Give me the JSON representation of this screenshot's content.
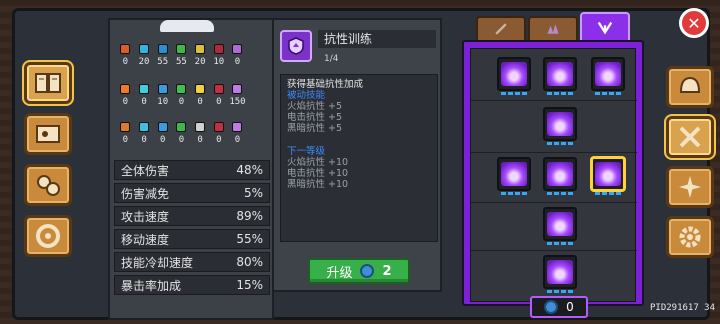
{
  "resources": {
    "row1": [
      {
        "icon": "fire-shield-icon",
        "color": "#e05a2a",
        "value": "0"
      },
      {
        "icon": "ice-shield-icon",
        "color": "#2fb6e0",
        "value": "20"
      },
      {
        "icon": "water-shield-icon",
        "color": "#2a8fd0",
        "value": "55"
      },
      {
        "icon": "poison-shield-icon",
        "color": "#3fb84a",
        "value": "55"
      },
      {
        "icon": "light-shield-icon",
        "color": "#d9c23a",
        "value": "20"
      },
      {
        "icon": "dark-shield-icon",
        "color": "#b02a3a",
        "value": "10"
      },
      {
        "icon": "arcane-shield-icon",
        "color": "#b06ad8",
        "value": "0"
      }
    ],
    "row2": [
      {
        "icon": "flame-icon",
        "color": "#f07a2a",
        "value": "0"
      },
      {
        "icon": "crystal-icon",
        "color": "#3ed0e0",
        "value": "0"
      },
      {
        "icon": "drop-icon",
        "color": "#3a9be0",
        "value": "10"
      },
      {
        "icon": "skull-icon",
        "color": "#3fc04a",
        "value": "0"
      },
      {
        "icon": "sun-icon",
        "color": "#f0d23a",
        "value": "0"
      },
      {
        "icon": "moon-icon",
        "color": "#c03040",
        "value": "0"
      },
      {
        "icon": "star-icon",
        "color": "#c07ae8",
        "value": "150"
      }
    ],
    "row3": [
      {
        "icon": "fire-staff-icon",
        "color": "#e07a2a",
        "value": "0"
      },
      {
        "icon": "ice-staff-icon",
        "color": "#3ec0e0",
        "value": "0"
      },
      {
        "icon": "water-staff-icon",
        "color": "#3a9be0",
        "value": "0"
      },
      {
        "icon": "poison-staff-icon",
        "color": "#3fb84a",
        "value": "0"
      },
      {
        "icon": "light-staff-icon",
        "color": "#d0d0d0",
        "value": "0"
      },
      {
        "icon": "dark-staff-icon",
        "color": "#c03040",
        "value": "0"
      },
      {
        "icon": "arcane-staff-icon",
        "color": "#c07ae8",
        "value": "0"
      }
    ]
  },
  "stats": [
    {
      "label": "全体伤害",
      "value": "48%"
    },
    {
      "label": "伤害减免",
      "value": "5%"
    },
    {
      "label": "攻击速度",
      "value": "89%"
    },
    {
      "label": "移动速度",
      "value": "55%"
    },
    {
      "label": "技能冷却速度",
      "value": "80%"
    },
    {
      "label": "暴击率加成",
      "value": "15%"
    }
  ],
  "skill": {
    "title": "抗性训练",
    "level": "1/4",
    "desc_main": "获得基础抗性加成",
    "current_head": "被动技能",
    "current": [
      "火焰抗性 +5",
      "电击抗性 +5",
      "黑暗抗性 +5"
    ],
    "next_head": "下一等级",
    "next": [
      "火焰抗性 +10",
      "电击抗性 +10",
      "黑暗抗性 +10"
    ]
  },
  "upgrade": {
    "label": "升级",
    "cost": "2"
  },
  "currency": {
    "value": "0"
  },
  "pid": "PID291617  34",
  "close_label": "✕"
}
